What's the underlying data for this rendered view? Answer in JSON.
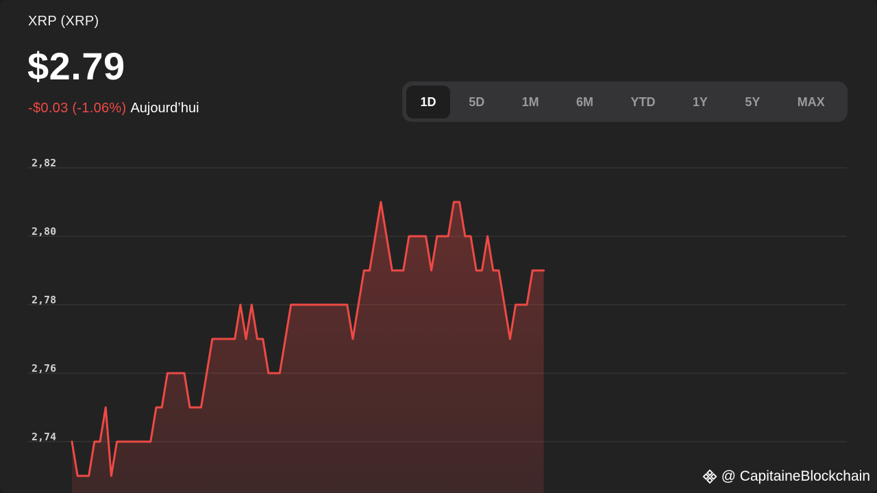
{
  "header": {
    "asset_name": "XRP (XRP)",
    "price": "$2.79",
    "change": "-$0.03 (-1.06%)",
    "change_period": "Aujourd’hui"
  },
  "range_tabs": [
    {
      "label": "1D",
      "active": true
    },
    {
      "label": "5D",
      "active": false
    },
    {
      "label": "1M",
      "active": false
    },
    {
      "label": "6M",
      "active": false
    },
    {
      "label": "YTD",
      "active": false
    },
    {
      "label": "1Y",
      "active": false
    },
    {
      "label": "5Y",
      "active": false
    },
    {
      "label": "MAX",
      "active": false
    }
  ],
  "watermark": {
    "icon": "binance-diamond-icon",
    "text": "@ CapitaineBlockchain"
  },
  "colors": {
    "background": "#222223",
    "line": "#ee4a44",
    "negative": "#ee4a44",
    "grid": "#3c3c3e"
  },
  "chart_data": {
    "type": "area",
    "title": "",
    "xlabel": "",
    "ylabel": "",
    "ylim": [
      2.725,
      2.825
    ],
    "yticks": [
      2.82,
      2.8,
      2.78,
      2.76,
      2.74
    ],
    "ytick_labels": [
      "2,82",
      "2,80",
      "2,78",
      "2,76",
      "2,74"
    ],
    "grid": true,
    "x_fraction_of_day": 0.6,
    "values": [
      2.74,
      2.73,
      2.73,
      2.73,
      2.74,
      2.74,
      2.75,
      2.73,
      2.74,
      2.74,
      2.74,
      2.74,
      2.74,
      2.74,
      2.74,
      2.75,
      2.75,
      2.76,
      2.76,
      2.76,
      2.76,
      2.75,
      2.75,
      2.75,
      2.76,
      2.77,
      2.77,
      2.77,
      2.77,
      2.77,
      2.78,
      2.77,
      2.78,
      2.77,
      2.77,
      2.76,
      2.76,
      2.76,
      2.77,
      2.78,
      2.78,
      2.78,
      2.78,
      2.78,
      2.78,
      2.78,
      2.78,
      2.78,
      2.78,
      2.78,
      2.77,
      2.78,
      2.79,
      2.79,
      2.8,
      2.81,
      2.8,
      2.79,
      2.79,
      2.79,
      2.8,
      2.8,
      2.8,
      2.8,
      2.79,
      2.8,
      2.8,
      2.8,
      2.81,
      2.81,
      2.8,
      2.8,
      2.79,
      2.79,
      2.8,
      2.79,
      2.79,
      2.78,
      2.77,
      2.78,
      2.78,
      2.78,
      2.79,
      2.79,
      2.79
    ]
  }
}
